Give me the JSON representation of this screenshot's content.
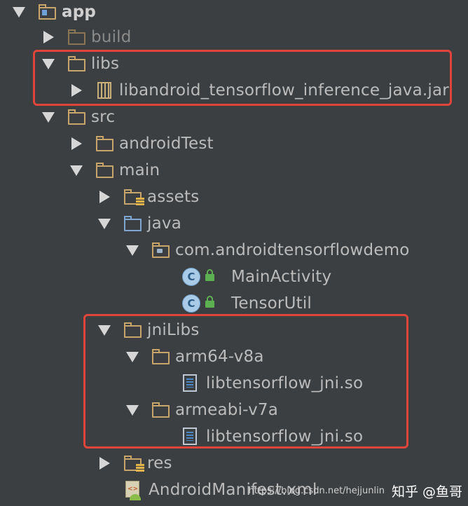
{
  "tree": {
    "app": "app",
    "build": "build",
    "libs": "libs",
    "jar": "libandroid_tensorflow_inference_java.jar",
    "src": "src",
    "android_test": "androidTest",
    "main": "main",
    "assets": "assets",
    "java": "java",
    "package": "com.androidtensorflowdemo",
    "main_activity": "MainActivity",
    "tensor_util": "TensorUtil",
    "jni_libs": "jniLibs",
    "arm64": "arm64-v8a",
    "so_arm64": "libtensorflow_jni.so",
    "armeabi": "armeabi-v7a",
    "so_armeabi": "libtensorflow_jni.so",
    "res": "res",
    "manifest": "AndroidManifest.xml"
  },
  "class_badge": "C",
  "manifest_tag": "<>",
  "watermark": {
    "url": "https://blog.csdn.net/hejjunlin",
    "zhihu": "知乎 @鱼哥"
  },
  "colors": {
    "background": "#3c3f41",
    "highlight": "#e0453b",
    "folder": "#c8a56a",
    "java_folder": "#7fa6d1"
  }
}
